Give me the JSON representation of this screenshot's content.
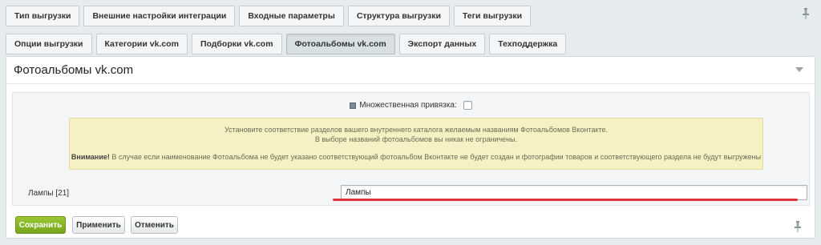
{
  "top_tabs": [
    {
      "label": "Тип выгрузки"
    },
    {
      "label": "Внешние настройки интеграции"
    },
    {
      "label": "Входные параметры"
    },
    {
      "label": "Структура выгрузки"
    },
    {
      "label": "Теги выгрузки"
    }
  ],
  "sub_tabs": [
    {
      "label": "Опции выгрузки"
    },
    {
      "label": "Категории vk.com"
    },
    {
      "label": "Подборки vk.com"
    },
    {
      "label": "Фотоальбомы vk.com",
      "active": true
    },
    {
      "label": "Экспорт данных"
    },
    {
      "label": "Техподдержка"
    }
  ],
  "panel": {
    "title": "Фотоальбомы vk.com",
    "multi_binding_label": "Множественная привязка:",
    "multi_binding_checked": false,
    "notice": {
      "line1": "Установите соответствие разделов вашего внутреннего каталога желаемым названиям Фотоальбомов Вконтакте.",
      "line2": "В выборе названий фотоальбомов вы никак не ограничены.",
      "warning_label": "Внимание!",
      "warning_text": " В случае если наименование Фотоальбома не будет указано соответствующий фотоальбом Вконтакте не будет создан и фотографии товаров и соответствующего раздела не будут выгружены"
    },
    "field_label": "Лампы [21]",
    "field_value": "Лампы"
  },
  "buttons": {
    "save": "Сохранить",
    "apply": "Применить",
    "cancel": "Отменить"
  },
  "colors": {
    "accent_green": "#76a41d",
    "annotation_red": "#e0343a",
    "notice_bg": "#f6f1c4"
  }
}
